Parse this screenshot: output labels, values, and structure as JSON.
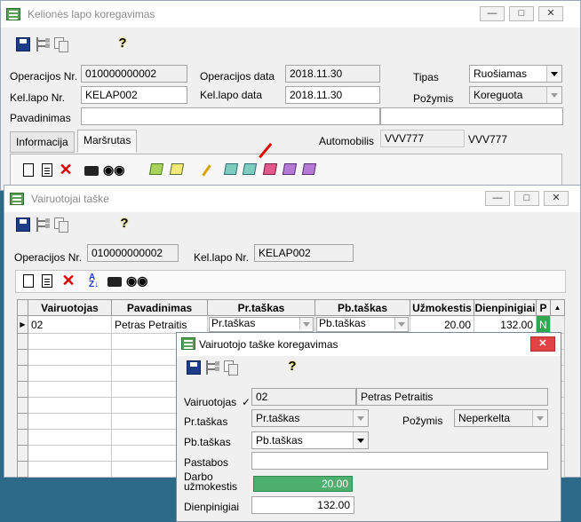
{
  "main_window": {
    "title": "Kelionės lapo koregavimas",
    "fields": {
      "operacijos_nr_label": "Operacijos Nr.",
      "operacijos_nr_value": "010000000002",
      "operacijos_data_label": "Operacijos data",
      "operacijos_data_value": "2018.11.30",
      "tipas_label": "Tipas",
      "tipas_value": "Ruošiamas",
      "kel_lapo_nr_label": "Kel.lapo Nr.",
      "kel_lapo_nr_value": "KELAP002",
      "kel_lapo_data_label": "Kel.lapo data",
      "kel_lapo_data_value": "2018.11.30",
      "pozymis_label": "Požymis",
      "pozymis_value": "Koreguota",
      "pavadinimas_label": "Pavadinimas",
      "pavadinimas_value": "",
      "extra_value": "",
      "automobilis_label": "Automobilis",
      "automobilis_code": "VVV777",
      "automobilis_name": "VVV777"
    },
    "tabs": [
      {
        "label": "Informacija"
      },
      {
        "label": "Maršrutas"
      }
    ]
  },
  "drivers_window": {
    "title": "Vairuotojai taške",
    "operacijos_nr_label": "Operacijos Nr.",
    "operacijos_nr_value": "010000000002",
    "kel_lapo_nr_label": "Kel.lapo Nr.",
    "kel_lapo_nr_value": "KELAP002",
    "columns": [
      "Vairuotojas",
      "Pavadinimas",
      "Pr.taškas",
      "Pb.taškas",
      "Užmokestis",
      "Dienpinigiai",
      "P"
    ],
    "rows": [
      {
        "vairuotojas": "02",
        "pavadinimas": "Petras Petraitis",
        "pr_taskas": "Pr.taškas",
        "pb_taskas": "Pb.taškas",
        "uzmokestis": "20.00",
        "dienpinigiai": "132.00",
        "p": "N"
      }
    ]
  },
  "edit_dialog": {
    "title": "Vairuotojo taške koregavimas",
    "vairuotojas_label": "Vairuotojas",
    "vairuotojas_code": "02",
    "vairuotojas_name": "Petras Petraitis",
    "pr_taskas_label": "Pr.taškas",
    "pr_taskas_value": "Pr.taškas",
    "pozymis_label": "Požymis",
    "pozymis_value": "Neperkelta",
    "pb_taskas_label": "Pb.taškas",
    "pb_taskas_value": "Pb.taškas",
    "pastabos_label": "Pastabos",
    "pastabos_value": "",
    "darbo_label_1": "Darbo",
    "darbo_label_2": "užmokestis",
    "darbo_value": "20.00",
    "dienpinigiai_label": "Dienpinigiai",
    "dienpinigiai_value": "132.00"
  },
  "colors": {
    "background": "#2d6a8a",
    "window_bg": "#f0f0f0",
    "close_button": "#e04343",
    "highlight_green": "#4caf6e",
    "arrow_red": "#e00000"
  }
}
